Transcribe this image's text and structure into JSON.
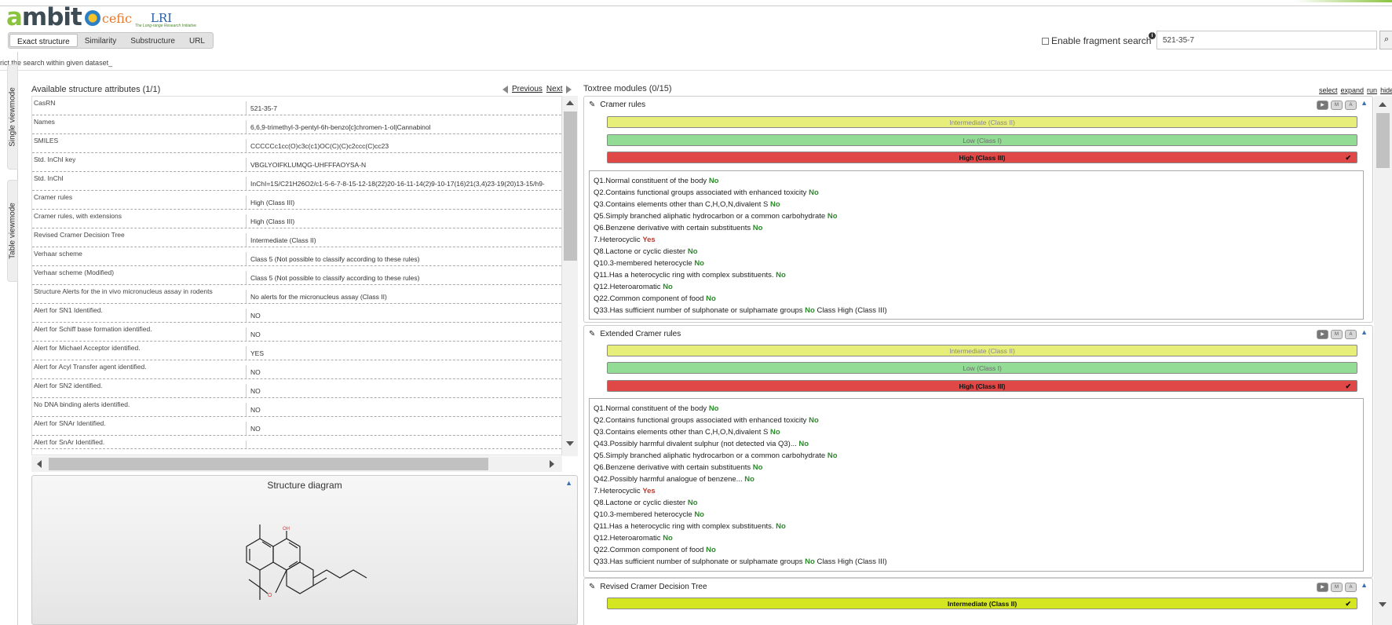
{
  "header": {
    "logo_text_a": "a",
    "logo_text_rest": "mbit",
    "cefic_text": "cefic",
    "lri_text": "LRI",
    "lri_sub": "The Long-range Research Initiative"
  },
  "tabs": [
    "Exact structure",
    "Similarity",
    "Substructure",
    "URL"
  ],
  "search": {
    "fragment_label": "Enable fragment search",
    "value": "521-35-7",
    "restrict_text": "rict the search within given dataset_"
  },
  "sidebar": {
    "single": "Single viewmode",
    "table": "Table viewmode"
  },
  "left": {
    "title": "Available structure attributes (1/1)",
    "prev": "Previous",
    "next": "Next",
    "rows": [
      {
        "k": "CasRN",
        "v": "521-35-7"
      },
      {
        "k": "Names",
        "v": "6,6,9-trimethyl-3-pentyl-6h-benzo[c]chromen-1-ol|Cannabinol"
      },
      {
        "k": "SMILES",
        "v": "CCCCCc1cc(O)c3c(c1)OC(C)(C)c2ccc(C)cc23"
      },
      {
        "k": "Std. InChI key",
        "v": "VBGLYOIFKLUMQG-UHFFFAOYSA-N"
      },
      {
        "k": "Std. InChI",
        "v": "InChI=1S/C21H26O2/c1-5-6-7-8-15-12-18(22)20-16-11-14(2)9-10-17(16)21(3,4)23-19(20)13-15/h9-"
      },
      {
        "k": "Cramer rules",
        "v": "High (Class III)"
      },
      {
        "k": "Cramer rules, with extensions",
        "v": "High (Class III)"
      },
      {
        "k": "Revised Cramer Decision Tree",
        "v": "Intermediate (Class II)"
      },
      {
        "k": "Verhaar scheme",
        "v": "Class 5 (Not possible to classify according to these rules)"
      },
      {
        "k": "Verhaar scheme (Modified)",
        "v": "Class 5 (Not possible to classify according to these rules)"
      },
      {
        "k": "Structure Alerts for the in vivo micronucleus assay in rodents",
        "v": "No alerts for the micronucleus assay (Class II)"
      },
      {
        "k": "Alert for SN1 Identified.",
        "v": "NO"
      },
      {
        "k": "Alert for Schiff base formation identified.",
        "v": "NO"
      },
      {
        "k": "Alert for Michael Acceptor identified.",
        "v": "YES"
      },
      {
        "k": "Alert for Acyl Transfer agent identified.",
        "v": "NO"
      },
      {
        "k": "Alert for SN2 identified.",
        "v": "NO"
      },
      {
        "k": "No DNA binding alerts identified.",
        "v": "NO"
      },
      {
        "k": "Alert for SNAr Identified.",
        "v": "NO"
      },
      {
        "k": "Alert for SnAr Identified.",
        "v": ""
      }
    ],
    "structure_title": "Structure diagram",
    "oh_label": "OH",
    "o_label": "O"
  },
  "right": {
    "title": "Toxtree modules (0/15)",
    "links": [
      "select",
      "expand",
      "run",
      "hide"
    ],
    "buttons": [
      "▶",
      "M",
      "A"
    ],
    "cramer": {
      "title": "Cramer rules",
      "classes": [
        "Intermediate (Class II)",
        "Low (Class I)",
        "High (Class III)"
      ],
      "questions": [
        {
          "q": "Q1.Normal constituent of the body",
          "a": "No"
        },
        {
          "q": "Q2.Contains functional groups associated with enhanced toxicity",
          "a": "No"
        },
        {
          "q": "Q3.Contains elements other than C,H,O,N,divalent S",
          "a": "No"
        },
        {
          "q": "Q5.Simply branched aliphatic hydrocarbon or a common carbohydrate",
          "a": "No"
        },
        {
          "q": "Q6.Benzene derivative with certain substituents",
          "a": "No"
        },
        {
          "q": "7.Heterocyclic",
          "a": "Yes"
        },
        {
          "q": "Q8.Lactone or cyclic diester",
          "a": "No"
        },
        {
          "q": "Q10.3-membered heterocycle",
          "a": "No"
        },
        {
          "q": "Q11.Has a heterocyclic ring with complex substituents.",
          "a": "No"
        },
        {
          "q": "Q12.Heteroaromatic",
          "a": "No"
        },
        {
          "q": "Q22.Common component of food",
          "a": "No"
        },
        {
          "q": "Q33.Has sufficient number of sulphonate or sulphamate groups",
          "a": "No",
          "tail": "Class High (Class III)"
        }
      ]
    },
    "extended": {
      "title": "Extended Cramer rules",
      "classes": [
        "Intermediate (Class II)",
        "Low (Class I)",
        "High (Class III)"
      ],
      "questions": [
        {
          "q": "Q1.Normal constituent of the body",
          "a": "No"
        },
        {
          "q": "Q2.Contains functional groups associated with enhanced toxicity",
          "a": "No"
        },
        {
          "q": "Q3.Contains elements other than C,H,O,N,divalent S",
          "a": "No"
        },
        {
          "q": "Q43.Possibly harmful divalent sulphur (not detected via Q3)...",
          "a": "No"
        },
        {
          "q": "Q5.Simply branched aliphatic hydrocarbon or a common carbohydrate",
          "a": "No"
        },
        {
          "q": "Q6.Benzene derivative with certain substituents",
          "a": "No"
        },
        {
          "q": "Q42.Possibly harmful analogue of benzene...",
          "a": "No"
        },
        {
          "q": "7.Heterocyclic",
          "a": "Yes"
        },
        {
          "q": "Q8.Lactone or cyclic diester",
          "a": "No"
        },
        {
          "q": "Q10.3-membered heterocycle",
          "a": "No"
        },
        {
          "q": "Q11.Has a heterocyclic ring with complex substituents.",
          "a": "No"
        },
        {
          "q": "Q12.Heteroaromatic",
          "a": "No"
        },
        {
          "q": "Q22.Common component of food",
          "a": "No"
        },
        {
          "q": "Q33.Has sufficient number of sulphonate or sulphamate groups",
          "a": "No",
          "tail": "Class High (Class III)"
        }
      ]
    },
    "revised": {
      "title": "Revised Cramer Decision Tree",
      "classes": [
        "Intermediate (Class II)"
      ]
    },
    "colors": {
      "intermediate": "#e8ee7a",
      "low": "#93dc96",
      "high": "#e04747",
      "intermediate_selected": "#d4e621"
    }
  }
}
